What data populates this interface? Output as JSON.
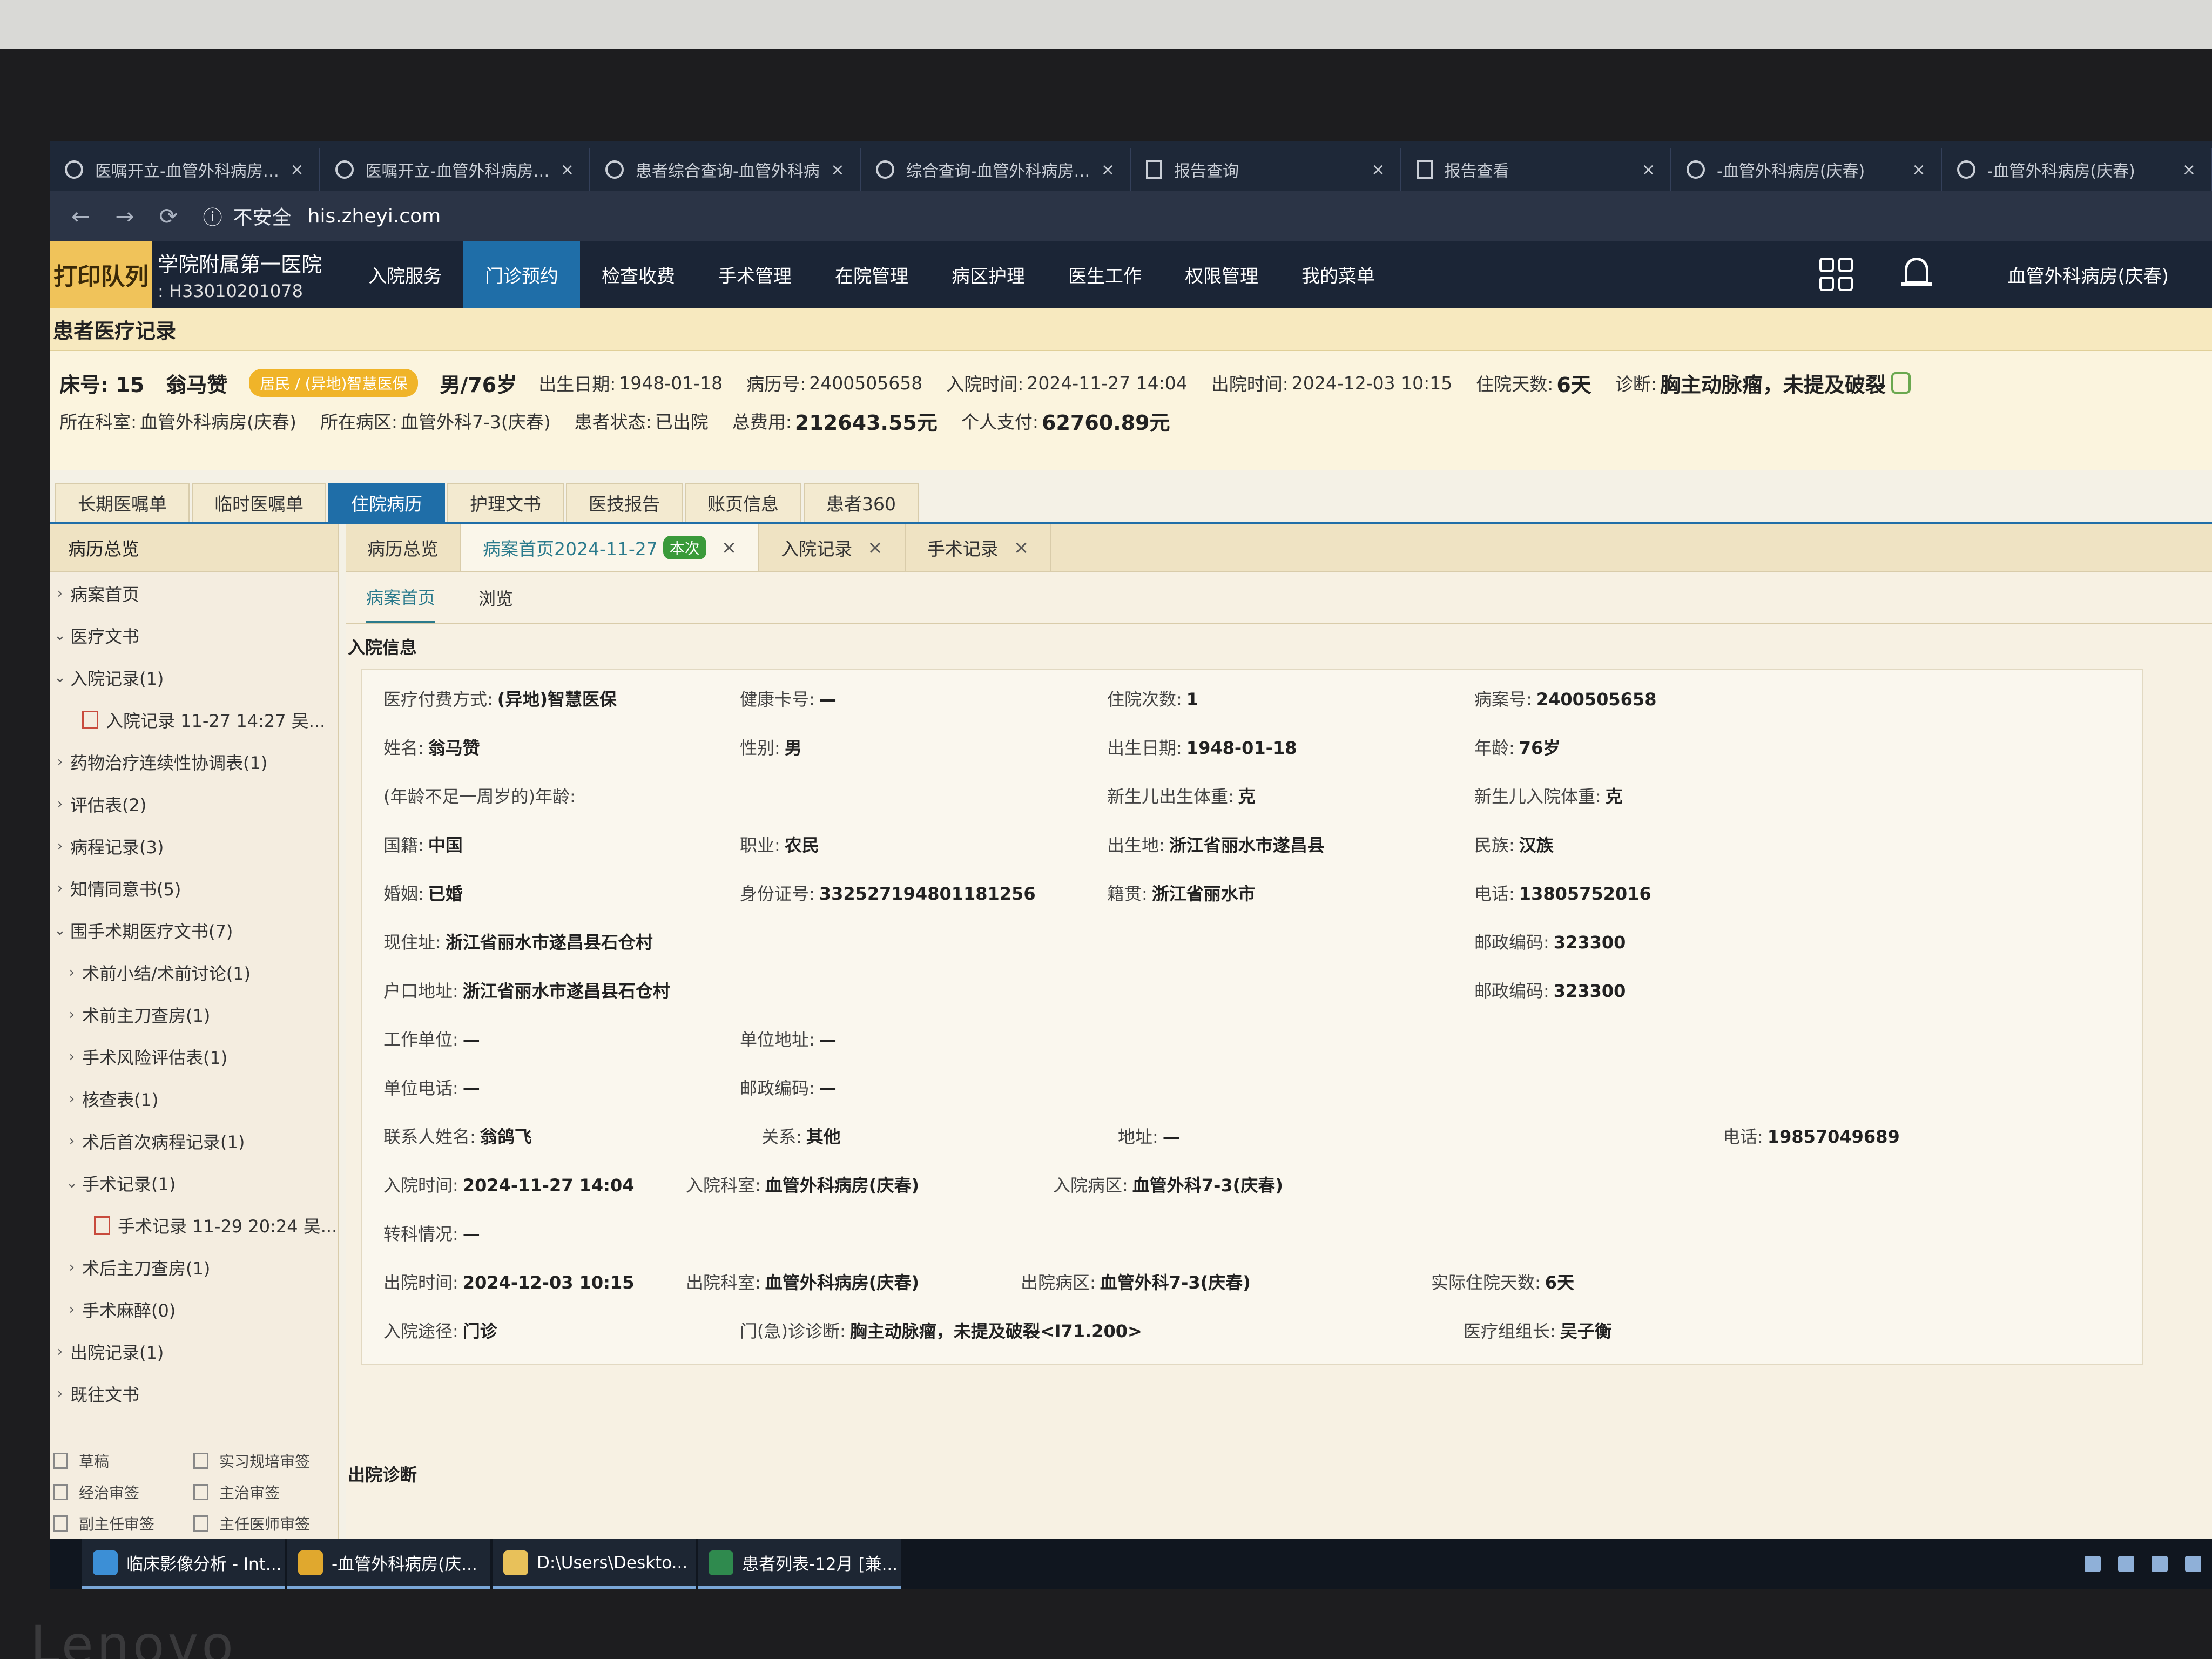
{
  "browser": {
    "tabs": [
      {
        "icon": "app-globe-icon",
        "title": "医嘱开立-血管外科病房(庆"
      },
      {
        "icon": "app-globe-icon",
        "title": "医嘱开立-血管外科病房(庆"
      },
      {
        "icon": "app-globe-icon",
        "title": "患者综合查询-血管外科病"
      },
      {
        "icon": "app-globe-icon",
        "title": "综合查询-血管外科病房(庆"
      },
      {
        "icon": "document-icon",
        "title": "报告查询"
      },
      {
        "icon": "document-icon",
        "title": "报告查看"
      },
      {
        "icon": "app-globe-icon",
        "title": "-血管外科病房(庆春)"
      },
      {
        "icon": "app-globe-icon",
        "title": "-血管外科病房(庆春)"
      }
    ],
    "security_label": "不安全",
    "url": "his.zheyi.com"
  },
  "app": {
    "logo_text": "打印队列",
    "hospital_name": "学院附属第一医院",
    "hospital_code": ": H33010201078",
    "menu": [
      "入院服务",
      "门诊预约",
      "检查收费",
      "手术管理",
      "在院管理",
      "病区护理",
      "医生工作",
      "权限管理",
      "我的菜单"
    ],
    "active_menu": "门诊预约",
    "department": "血管外科病房(庆春)"
  },
  "page_title": "患者医疗记录",
  "patient": {
    "bed_label": "床号:",
    "bed": "15",
    "name": "翁马赞",
    "insurance_badge": "居民 / (异地)智慧医保",
    "gender_age": "男/76岁",
    "birth_label": "出生日期:",
    "birth": "1948-01-18",
    "record_no_label": "病历号:",
    "record_no": "2400505658",
    "admit_label": "入院时间:",
    "admit_time": "2024-11-27 14:04",
    "discharge_label": "出院时间:",
    "discharge_time": "2024-12-03 10:15",
    "days_label": "住院天数:",
    "days": "6天",
    "diagnosis_label": "诊断:",
    "diagnosis": "胸主动脉瘤，未提及破裂",
    "dept_label": "所在科室:",
    "dept": "血管外科病房(庆春)",
    "ward_label": "所在病区:",
    "ward": "血管外科7-3(庆春)",
    "status_label": "患者状态:",
    "status": "已出院",
    "total_label": "总费用:",
    "total_fee": "212643.55元",
    "self_label": "个人支付:",
    "self_pay": "62760.89元"
  },
  "tabs_primary": [
    "长期医嘱单",
    "临时医嘱单",
    "住院病历",
    "护理文书",
    "医技报告",
    "账页信息",
    "患者360"
  ],
  "tabs_primary_active": "住院病历",
  "sidebar": {
    "head": "病历总览",
    "items": [
      {
        "caret": "›",
        "label": "病案首页",
        "indent": 0
      },
      {
        "caret": "⌄",
        "label": "医疗文书",
        "indent": 0
      },
      {
        "caret": "⌄",
        "label": "入院记录(1)",
        "indent": 0
      },
      {
        "caret": "",
        "label": "入院记录 11-27 14:27 吴...",
        "indent": 1,
        "file": true
      },
      {
        "caret": "›",
        "label": "药物治疗连续性协调表(1)",
        "indent": 0
      },
      {
        "caret": "›",
        "label": "评估表(2)",
        "indent": 0
      },
      {
        "caret": "›",
        "label": "病程记录(3)",
        "indent": 0
      },
      {
        "caret": "›",
        "label": "知情同意书(5)",
        "indent": 0
      },
      {
        "caret": "⌄",
        "label": "围手术期医疗文书(7)",
        "indent": 0
      },
      {
        "caret": "›",
        "label": "术前小结/术前讨论(1)",
        "indent": 1
      },
      {
        "caret": "›",
        "label": "术前主刀查房(1)",
        "indent": 1
      },
      {
        "caret": "›",
        "label": "手术风险评估表(1)",
        "indent": 1
      },
      {
        "caret": "›",
        "label": "核查表(1)",
        "indent": 1
      },
      {
        "caret": "›",
        "label": "术后首次病程记录(1)",
        "indent": 1
      },
      {
        "caret": "⌄",
        "label": "手术记录(1)",
        "indent": 1
      },
      {
        "caret": "",
        "label": "手术记录 11-29 20:24 吴...",
        "indent": 2,
        "file": true
      },
      {
        "caret": "›",
        "label": "术后主刀查房(1)",
        "indent": 1
      },
      {
        "caret": "›",
        "label": "手术麻醉(0)",
        "indent": 1
      },
      {
        "caret": "›",
        "label": "出院记录(1)",
        "indent": 0
      },
      {
        "caret": "›",
        "label": "既往文书",
        "indent": 0
      }
    ],
    "legend": [
      [
        "草稿",
        "实习规培审签"
      ],
      [
        "经治审签",
        "主治审签"
      ],
      [
        "副主任审签",
        "主任医师审签"
      ]
    ]
  },
  "tabs_secondary": [
    {
      "label": "病历总览",
      "closable": false,
      "now": ""
    },
    {
      "label": "病案首页2024-11-27",
      "closable": true,
      "now": "本次"
    },
    {
      "label": "入院记录",
      "closable": true,
      "now": ""
    },
    {
      "label": "手术记录",
      "closable": true,
      "now": ""
    }
  ],
  "tabs_tertiary": [
    "病案首页",
    "浏览"
  ],
  "section_admission": "入院信息",
  "section_discharge": "出院诊断",
  "form": {
    "pay_method": {
      "k": "医疗付费方式:",
      "v": "(异地)智慧医保"
    },
    "health_card": {
      "k": "健康卡号:",
      "v": "—"
    },
    "visits": {
      "k": "住院次数:",
      "v": "1"
    },
    "case_no": {
      "k": "病案号:",
      "v": "2400505658"
    },
    "name": {
      "k": "姓名:",
      "v": "翁马赞"
    },
    "gender": {
      "k": "性别:",
      "v": "男"
    },
    "birth": {
      "k": "出生日期:",
      "v": "1948-01-18"
    },
    "age": {
      "k": "年龄:",
      "v": "76岁"
    },
    "infant_age": {
      "k": "(年龄不足一周岁的)年龄:",
      "v": ""
    },
    "newborn_birth_wt": {
      "k": "新生儿出生体重:",
      "v": "克"
    },
    "newborn_admit_wt": {
      "k": "新生儿入院体重:",
      "v": "克"
    },
    "nationality": {
      "k": "国籍:",
      "v": "中国"
    },
    "job": {
      "k": "职业:",
      "v": "农民"
    },
    "birthplace": {
      "k": "出生地:",
      "v": "浙江省丽水市遂昌县"
    },
    "ethnic": {
      "k": "民族:",
      "v": "汉族"
    },
    "marital": {
      "k": "婚姻:",
      "v": "已婚"
    },
    "id_no": {
      "k": "身份证号:",
      "v": "332527194801181256"
    },
    "native": {
      "k": "籍贯:",
      "v": "浙江省丽水市"
    },
    "phone": {
      "k": "电话:",
      "v": "13805752016"
    },
    "address": {
      "k": "现住址:",
      "v": "浙江省丽水市遂昌县石仓村"
    },
    "zip1": {
      "k": "邮政编码:",
      "v": "323300"
    },
    "hukou": {
      "k": "户口地址:",
      "v": "浙江省丽水市遂昌县石仓村"
    },
    "zip2": {
      "k": "邮政编码:",
      "v": "323300"
    },
    "employer": {
      "k": "工作单位:",
      "v": "—"
    },
    "employer_addr": {
      "k": "单位地址:",
      "v": "—"
    },
    "employer_phone": {
      "k": "单位电话:",
      "v": "—"
    },
    "employer_zip": {
      "k": "邮政编码:",
      "v": "—"
    },
    "contact": {
      "k": "联系人姓名:",
      "v": "翁鸽飞"
    },
    "relation": {
      "k": "关系:",
      "v": "其他"
    },
    "contact_addr": {
      "k": "地址:",
      "v": "—"
    },
    "contact_phone": {
      "k": "电话:",
      "v": "19857049689"
    },
    "admit_time": {
      "k": "入院时间:",
      "v": "2024-11-27 14:04"
    },
    "admit_dept": {
      "k": "入院科室:",
      "v": "血管外科病房(庆春)"
    },
    "admit_ward": {
      "k": "入院病区:",
      "v": "血管外科7-3(庆春)"
    },
    "transfer": {
      "k": "转科情况:",
      "v": "—"
    },
    "discharge_time": {
      "k": "出院时间:",
      "v": "2024-12-03 10:15"
    },
    "discharge_dept": {
      "k": "出院科室:",
      "v": "血管外科病房(庆春)"
    },
    "discharge_ward": {
      "k": "出院病区:",
      "v": "血管外科7-3(庆春)"
    },
    "actual_days": {
      "k": "实际住院天数:",
      "v": "6天"
    },
    "admit_route": {
      "k": "入院途径:",
      "v": "门诊"
    },
    "outpatient_dx": {
      "k": "门(急)诊诊断:",
      "v": "胸主动脉瘤，未提及破裂<I71.200>"
    },
    "team_leader": {
      "k": "医疗组组长:",
      "v": "吴子衡"
    }
  },
  "taskbar": [
    {
      "icon": "ie-browser-icon",
      "label": "临床影像分析 - Int...",
      "color": "#3c8fd6"
    },
    {
      "icon": "chrome-icon",
      "label": "-血管外科病房(庆...",
      "color": "#e0a82e"
    },
    {
      "icon": "folder-icon",
      "label": "D:\\Users\\Deskto...",
      "color": "#e8c15a"
    },
    {
      "icon": "excel-icon",
      "label": "患者列表-12月  [兼...",
      "color": "#2f8a4e"
    }
  ],
  "monitor_brand": "Lenovo"
}
